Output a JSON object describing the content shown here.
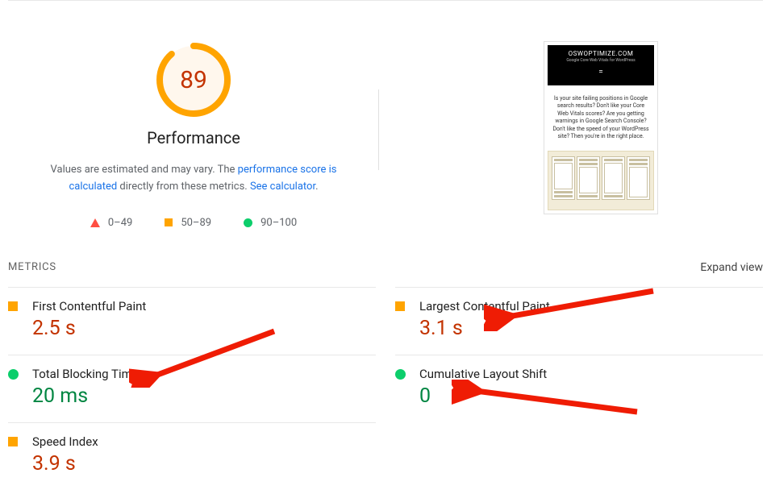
{
  "gauge": {
    "score": "89",
    "title": "Performance"
  },
  "description": {
    "line1_a": "Values are estimated and may vary. The ",
    "link1": "performance score is calculated",
    "line2_a": " directly from these metrics. ",
    "link2": "See calculator",
    "dot": "."
  },
  "legend": {
    "fail": "0–49",
    "avg": "50–89",
    "pass": "90–100"
  },
  "preview": {
    "brand": "OSWOPTIMIZE.COM",
    "sub": "Google Core Web Vitals for WordPress",
    "menu": "=",
    "body": "Is your site failing positions in Google search results? Don't like your Core Web Vitals scores? Are you getting warnings in Google Search Console? Don't like the speed of your WordPress site? Then you're in the right place."
  },
  "metrics_header": {
    "label": "METRICS",
    "expand": "Expand view"
  },
  "metrics": {
    "fcp": {
      "name": "First Contentful Paint",
      "value": "2.5 s"
    },
    "lcp": {
      "name": "Largest Contentful Paint",
      "value": "3.1 s"
    },
    "tbt": {
      "name": "Total Blocking Time",
      "value": "20 ms"
    },
    "cls": {
      "name": "Cumulative Layout Shift",
      "value": "0"
    },
    "si": {
      "name": "Speed Index",
      "value": "3.9 s"
    }
  }
}
